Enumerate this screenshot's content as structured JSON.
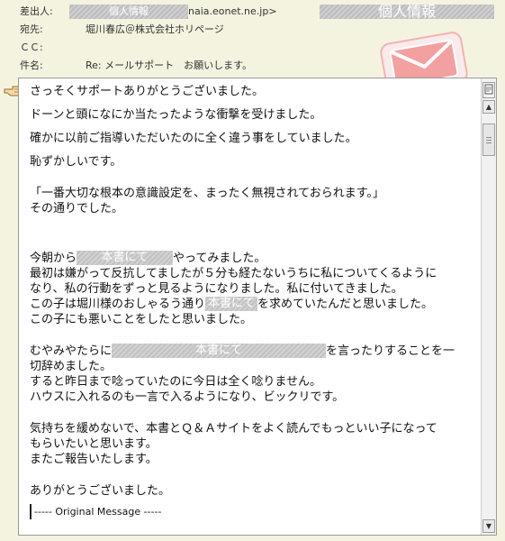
{
  "header": {
    "from": {
      "label": "差出人:",
      "masked_name": "個人情報",
      "email_tail": "naia.eonet.ne.jp>",
      "masked_right": "個人情報"
    },
    "to": {
      "label": "宛先:",
      "value": "堀川春広＠株式会社ホリページ"
    },
    "cc": {
      "label": "ＣＣ:",
      "value": ""
    },
    "subject": {
      "label": "件名:",
      "value": "Re: メールサポート　お願いします。"
    }
  },
  "message": {
    "line1": "さっそくサポートありがとうございました。",
    "line2": "ドーンと頭になにか当たったような衝撃を受けました。",
    "line3": "確かに以前ご指導いただいたのに全く違う事をしていました。",
    "line4": "恥ずかしいです。",
    "line5": "「一番大切な根本の意識設定を、まったく無視されておられます。」",
    "line6": "その通りでした。",
    "para3": {
      "line1_before": "今朝から",
      "line1_mask": "本書にて",
      "line1_after": "やってみました。",
      "line2": "最初は嫌がって反抗してましたが５分も経たないうちに私についてくるように",
      "line3": "なり、私の行動をずっと見るようになりました。私に付いてきました。",
      "line4_before": "この子は堀川様のおしゃるう通り",
      "line4_mask": "本書にて",
      "line4_after": "を求めていたんだと思いました。",
      "line5": "この子にも悪いことをしたと思いました。"
    },
    "para4": {
      "line1_before": "むやみやたらに",
      "line1_mask": "本書にて",
      "line1_after": "を言ったりすることを一",
      "line2": "切辞めました。",
      "line3": "すると昨日まで唸っていたのに今日は全く唸りません。",
      "line4": "ハウスに入れるのも一言で入るようになり、ビックリです。"
    },
    "para5": {
      "line1": "気持ちを緩めないで、本書とＱ＆Ａサイトをよく読んでもっといい子になって",
      "line2": "もらいたいと思います。",
      "line3": "またご報告いたします。"
    },
    "closing": "ありがとうございました。",
    "original": "----- Original Message -----"
  },
  "colors": {
    "background": "#f4f3df",
    "envelope": "#f2a0a0"
  },
  "icons": {
    "envelope": "envelope-icon",
    "pointer": "hand-pointer-icon"
  }
}
